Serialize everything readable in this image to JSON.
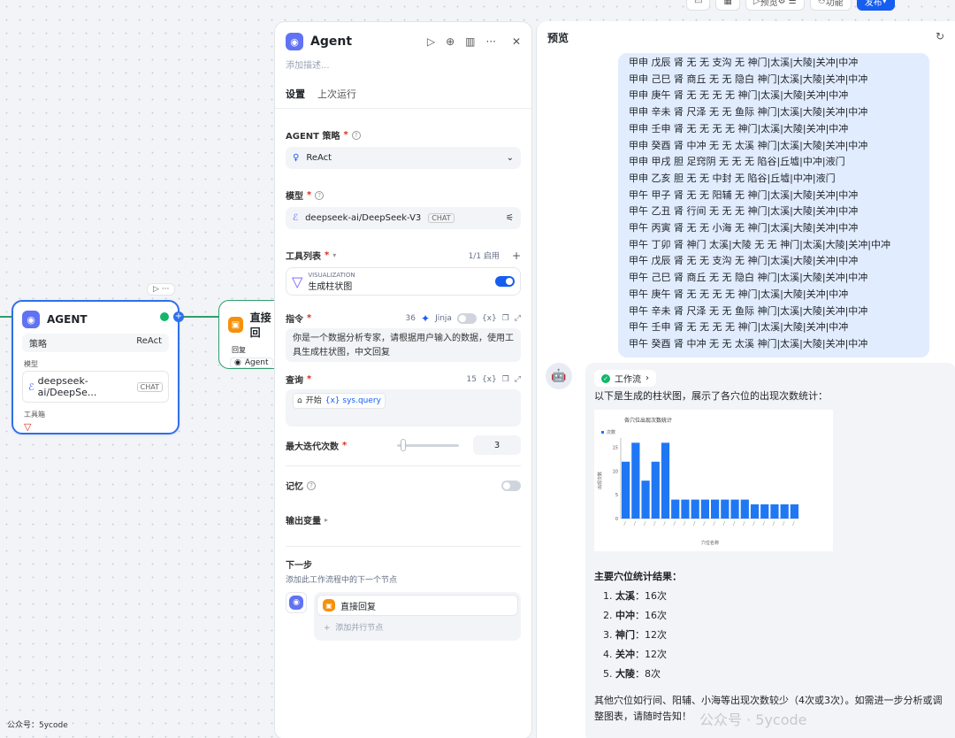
{
  "topbar": {
    "btn1": "▭",
    "btn2": "▦",
    "preview": "预览",
    "features": "功能",
    "publish": "发布"
  },
  "canvas": {
    "agent_node": {
      "title": "AGENT",
      "strategy_label": "策略",
      "strategy_value": "ReAct",
      "model_label": "模型",
      "model_value": "deepseek-ai/DeepSe...",
      "model_badge": "CHAT",
      "tools_label": "工具箱"
    },
    "reply_node": {
      "title": "直接回",
      "reply_label": "回复",
      "reply_value": "Agent"
    },
    "footer_watermark": "公众号：5ycode"
  },
  "panel": {
    "title": "Agent",
    "desc_placeholder": "添加描述...",
    "tabs": [
      "设置",
      "上次运行"
    ],
    "strategy": {
      "label": "AGENT 策略",
      "value": "ReAct"
    },
    "model": {
      "label": "模型",
      "value": "deepseek-ai/DeepSeek-V3",
      "badge": "CHAT"
    },
    "tools": {
      "label": "工具列表",
      "count": "1/1 启用",
      "provider": "VISUALIZATION",
      "name": "生成柱状图"
    },
    "instruction": {
      "label": "指令",
      "count": "36",
      "jinja": "Jinja",
      "text": "你是一个数据分析专家，请根据用户输入的数据，使用工具生成柱状图，中文回复"
    },
    "query": {
      "label": "查询",
      "count": "15",
      "start": "开始",
      "var": "{x} sys.query"
    },
    "max_iter": {
      "label": "最大迭代次数",
      "value": "3",
      "fraction": 0.1
    },
    "memory": {
      "label": "记忆"
    },
    "output": {
      "label": "输出变量"
    },
    "next": {
      "label": "下一步",
      "hint": "添加此工作流程中的下一个节点",
      "node": "直接回复",
      "add": "添加并行节点"
    }
  },
  "preview": {
    "title": "预览",
    "user_lines": [
      "甲申 戊辰 肾 无 无 支沟 无 神门|太溪|大陵|关冲|中冲",
      "甲申 己巳 肾 商丘 无 无 隐白 神门|太溪|大陵|关冲|中冲",
      "甲申 庚午 肾 无 无 无 无 神门|太溪|大陵|关冲|中冲",
      "甲申 辛未 肾 尺泽 无 无 鱼际 神门|太溪|大陵|关冲|中冲",
      "甲申 壬申 肾 无 无 无 无 神门|太溪|大陵|关冲|中冲",
      "甲申 癸酉 肾 中冲 无 无 太溪 神门|太溪|大陵|关冲|中冲",
      "甲申 甲戌 胆 足窍阴 无 无 无 陷谷|丘墟|中冲|液门",
      "甲申 乙亥 胆 无 无 中封 无 陷谷|丘墟|中冲|液门",
      "甲午 甲子 肾 无 无 阳辅 无 神门|太溪|大陵|关冲|中冲",
      "甲午 乙丑 肾 行间 无 无 无 神门|太溪|大陵|关冲|中冲",
      "甲午 丙寅 肾 无 无 小海 无 神门|太溪|大陵|关冲|中冲",
      "甲午 丁卯 肾 神门 太溪|大陵 无 无 神门|太溪|大陵|关冲|中冲",
      "甲午 戊辰 肾 无 无 支沟 无 神门|太溪|大陵|关冲|中冲",
      "甲午 己巳 肾 商丘 无 无 隐白 神门|太溪|大陵|关冲|中冲",
      "甲午 庚午 肾 无 无 无 无 神门|太溪|大陵|关冲|中冲",
      "甲午 辛未 肾 尺泽 无 无 鱼际 神门|太溪|大陵|关冲|中冲",
      "甲午 壬申 肾 无 无 无 无 神门|太溪|大陵|关冲|中冲",
      "甲午 癸酉 肾 中冲 无 无 太溪 神门|太溪|大陵|关冲|中冲"
    ],
    "workflow_label": "工作流",
    "intro": "以下是生成的柱状图，展示了各穴位的出现次数统计：",
    "summary_title": "主要穴位统计结果：",
    "results": [
      {
        "n": "1.",
        "name": "太溪",
        "val": "：16次"
      },
      {
        "n": "2.",
        "name": "中冲",
        "val": "：16次"
      },
      {
        "n": "3.",
        "name": "神门",
        "val": "：12次"
      },
      {
        "n": "4.",
        "name": "关冲",
        "val": "：12次"
      },
      {
        "n": "5.",
        "name": "大陵",
        "val": "：8次"
      }
    ],
    "footer": "其他穴位如行间、阳辅、小海等出现次数较少（4次或3次）。如需进一步分析或调整图表，请随时告知！",
    "watermark": "公众号 · 5ycode"
  },
  "chart_data": {
    "type": "bar",
    "title": "各穴位出现次数统计",
    "legend": "次数",
    "xlabel": "穴位名称",
    "ylabel": "出现次数",
    "ylim": [
      0,
      17
    ],
    "yticks": [
      "0",
      "5",
      "10",
      "15"
    ],
    "values": [
      12,
      16,
      8,
      12,
      16,
      4,
      4,
      4,
      4,
      4,
      4,
      4,
      4,
      3,
      3,
      3,
      3,
      3
    ],
    "color": "#1f77f4"
  }
}
